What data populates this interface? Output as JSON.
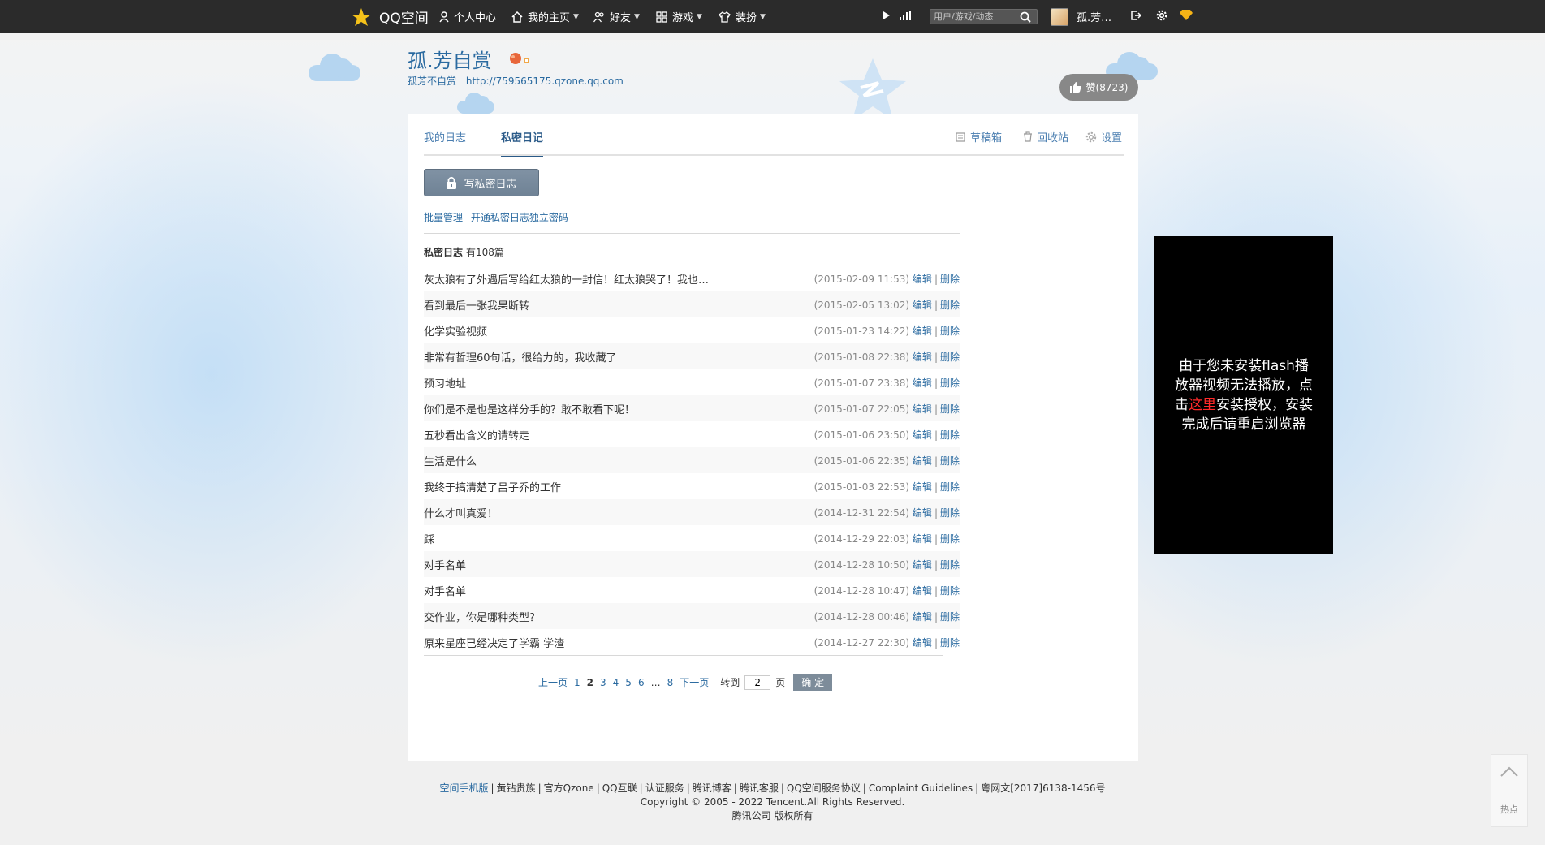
{
  "topbar": {
    "logo_text": "QQ空间",
    "nav": [
      {
        "label": "个人中心",
        "icon": "user-icon",
        "caret": false
      },
      {
        "label": "我的主页",
        "icon": "home-icon",
        "caret": true
      },
      {
        "label": "好友",
        "icon": "friends-icon",
        "caret": true
      },
      {
        "label": "游戏",
        "icon": "grid-icon",
        "caret": true
      },
      {
        "label": "装扮",
        "icon": "shirt-icon",
        "caret": true
      }
    ],
    "search_placeholder": "用户/游戏/动态",
    "username": "孤.芳…"
  },
  "header": {
    "title": "孤.芳自赏",
    "subtitle": "孤芳不自赏",
    "url": "http://759565175.qzone.qq.com",
    "like_label": "赞(8723)"
  },
  "tabs": {
    "my_blog": "我的日志",
    "private_diary": "私密日记",
    "drafts": "草稿箱",
    "recycle": "回收站",
    "settings": "设置"
  },
  "actions": {
    "write_label": "写私密日志",
    "batch_manage": "批量管理",
    "enable_password": "开通私密日志独立密码"
  },
  "list": {
    "heading": "私密日志",
    "count": "有108篇",
    "edit_label": "编辑",
    "delete_label": "删除",
    "entries": [
      {
        "title": "灰太狼有了外遇后写给红太狼的一封信！红太狼哭了！我也…",
        "date": "(2015-02-09 11:53)"
      },
      {
        "title": "看到最后一张我果断转",
        "date": "(2015-02-05 13:02)"
      },
      {
        "title": "化学实验视频",
        "date": "(2015-01-23 14:22)"
      },
      {
        "title": "非常有哲理60句话，很给力的，我收藏了",
        "date": "(2015-01-08 22:38)"
      },
      {
        "title": "预习地址",
        "date": "(2015-01-07 23:38)"
      },
      {
        "title": "你们是不是也是这样分手的？敢不敢看下呢！",
        "date": "(2015-01-07 22:05)"
      },
      {
        "title": "五秒看出含义的请转走",
        "date": "(2015-01-06 23:50)"
      },
      {
        "title": "生活是什么",
        "date": "(2015-01-06 22:35)"
      },
      {
        "title": "我终于搞清楚了吕子乔的工作",
        "date": "(2015-01-03 22:53)"
      },
      {
        "title": "什么才叫真爱！",
        "date": "(2014-12-31 22:54)"
      },
      {
        "title": "踩",
        "date": "(2014-12-29 22:03)"
      },
      {
        "title": "对手名单",
        "date": "(2014-12-28 10:50)"
      },
      {
        "title": "对手名单",
        "date": "(2014-12-28 10:47)"
      },
      {
        "title": "交作业，你是哪种类型？",
        "date": "(2014-12-28 00:46)"
      },
      {
        "title": "原来星座已经决定了学霸 学渣",
        "date": "(2014-12-27 22:30)"
      }
    ]
  },
  "pager": {
    "prev": "上一页",
    "pages": [
      "1",
      "2",
      "3",
      "4",
      "5",
      "6"
    ],
    "current": "2",
    "dots": "…",
    "last": "8",
    "next": "下一页",
    "goto": "转到",
    "input_value": "2",
    "unit": "页",
    "ok": "确 定"
  },
  "flash": {
    "before": "由于您未安装flash播放器视频无法播放，点击",
    "link": "这里",
    "after": "安装授权，安装完成后请重启浏览器"
  },
  "footer": {
    "links": [
      "空间手机版",
      "黄钻贵族",
      "官方Qzone",
      "QQ互联",
      "认证服务",
      "腾讯博客",
      "腾讯客服",
      "QQ空间服务协议",
      "Complaint Guidelines",
      "粤网文[2017]6138-1456号"
    ],
    "copyright": "Copyright © 2005 - 2022 Tencent.All Rights Reserved.",
    "company": "腾讯公司 版权所有"
  },
  "back_top": {
    "hot_label": "热点"
  },
  "colors": {
    "accent": "#2a6aa0",
    "topbar": "#2b2b2b",
    "like_button": "#888888"
  }
}
